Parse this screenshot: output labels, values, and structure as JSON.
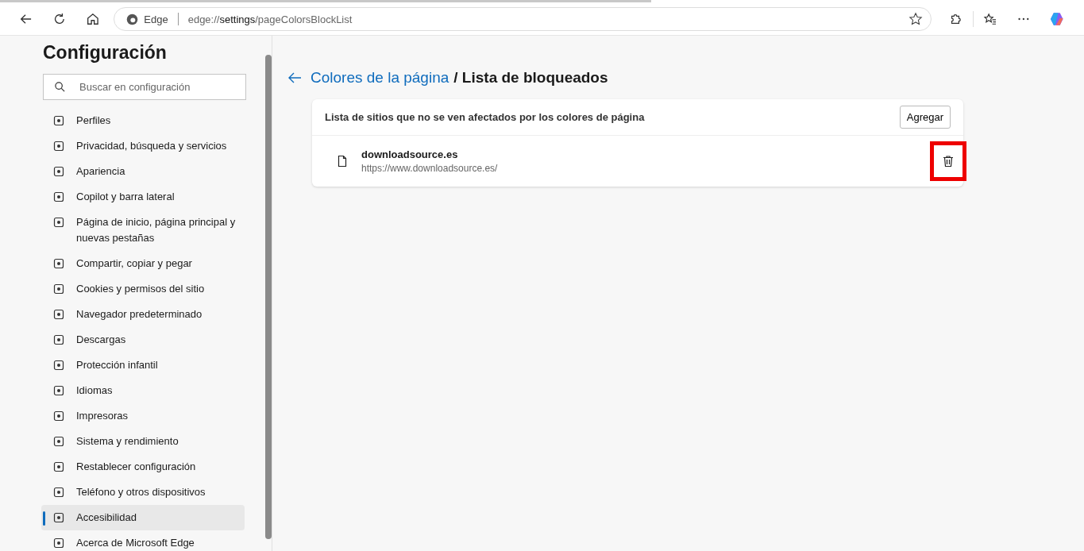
{
  "browser": {
    "site_label": "Edge",
    "address": "edge://**settings**/pageColorsBlockList"
  },
  "sidebar": {
    "title": "Configuración",
    "search": {
      "placeholder": "Buscar en configuración"
    },
    "items": [
      {
        "label": "Perfiles",
        "selected": false
      },
      {
        "label": "Privacidad, búsqueda y servicios",
        "selected": false
      },
      {
        "label": "Apariencia",
        "selected": false
      },
      {
        "label": "Copilot y barra lateral",
        "selected": false
      },
      {
        "label": "Página de inicio, página principal y nuevas pestañas",
        "selected": false
      },
      {
        "label": "Compartir, copiar y pegar",
        "selected": false
      },
      {
        "label": "Cookies y permisos del sitio",
        "selected": false
      },
      {
        "label": "Navegador predeterminado",
        "selected": false
      },
      {
        "label": "Descargas",
        "selected": false
      },
      {
        "label": "Protección infantil",
        "selected": false
      },
      {
        "label": "Idiomas",
        "selected": false
      },
      {
        "label": "Impresoras",
        "selected": false
      },
      {
        "label": "Sistema y rendimiento",
        "selected": false
      },
      {
        "label": "Restablecer configuración",
        "selected": false
      },
      {
        "label": "Teléfono y otros dispositivos",
        "selected": false
      },
      {
        "label": "Accesibilidad",
        "selected": true
      },
      {
        "label": "Acerca de Microsoft Edge",
        "selected": false
      }
    ]
  },
  "main": {
    "breadcrumb_link": "Colores de la página",
    "breadcrumb_current": "/ Lista de bloqueados",
    "card": {
      "description": "Lista de sitios que no se ven afectados por los colores de página",
      "add_button": "Agregar",
      "sites": [
        {
          "name": "downloadsource.es",
          "url": "https://www.downloadsource.es/",
          "delete_highlighted": true
        }
      ]
    }
  }
}
